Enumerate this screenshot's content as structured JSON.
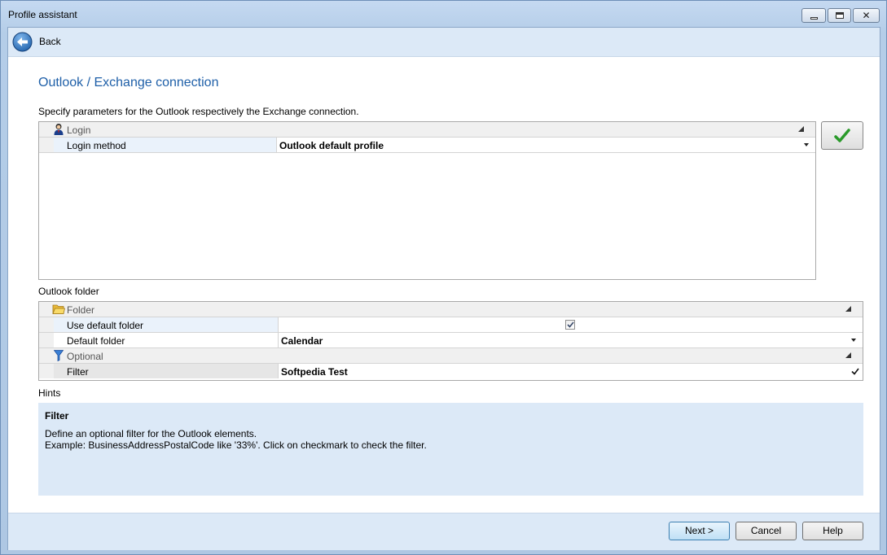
{
  "window": {
    "title": "Profile assistant"
  },
  "nav": {
    "back_label": "Back"
  },
  "page": {
    "title": "Outlook / Exchange connection",
    "instruction": "Specify parameters for the Outlook respectively the Exchange connection."
  },
  "login_grid": {
    "category": "Login",
    "rows": [
      {
        "name": "Login method",
        "value": "Outlook default profile"
      }
    ]
  },
  "folder_section_label": "Outlook folder",
  "folder_grid": {
    "folder_category": "Folder",
    "use_default_folder": {
      "name": "Use default folder",
      "checked": true
    },
    "default_folder": {
      "name": "Default folder",
      "value": "Calendar"
    },
    "optional_category": "Optional",
    "filter": {
      "name": "Filter",
      "value": "Softpedia Test"
    }
  },
  "hints": {
    "label": "Hints",
    "title": "Filter",
    "line1": "Define an optional filter for the Outlook elements.",
    "line2": "Example: BusinessAddressPostalCode like '33%'. Click on checkmark to check the filter."
  },
  "footer": {
    "next_label": "Next >",
    "cancel_label": "Cancel",
    "help_label": "Help"
  },
  "icons": {
    "back": "back-arrow-icon",
    "login": "user-icon",
    "folder": "folder-icon",
    "optional": "filter-icon",
    "check": "checkmark-icon"
  },
  "colors": {
    "accent": "#1e5fa8",
    "panel": "#dce9f7",
    "check_green": "#2a9a2a"
  }
}
